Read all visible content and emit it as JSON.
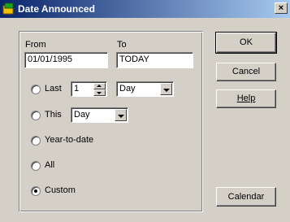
{
  "window": {
    "title": "Date Announced",
    "close_label": "×",
    "icon": "app-icon"
  },
  "dates": {
    "from_label": "From",
    "from_value": "01/01/1995",
    "to_label": "To",
    "to_value": "TODAY"
  },
  "options": {
    "last": {
      "label": "Last",
      "number": "1",
      "unit": "Day"
    },
    "this": {
      "label": "This",
      "unit": "Day"
    },
    "ytd": {
      "label": "Year-to-date"
    },
    "all": {
      "label": "All"
    },
    "custom": {
      "label": "Custom"
    },
    "selected": "custom"
  },
  "buttons": {
    "ok": "OK",
    "cancel": "Cancel",
    "help": "Help",
    "calendar": "Calendar"
  },
  "colors": {
    "titlebar_start": "#0a246a",
    "titlebar_end": "#a6caf0",
    "face": "#d4d0c8"
  }
}
